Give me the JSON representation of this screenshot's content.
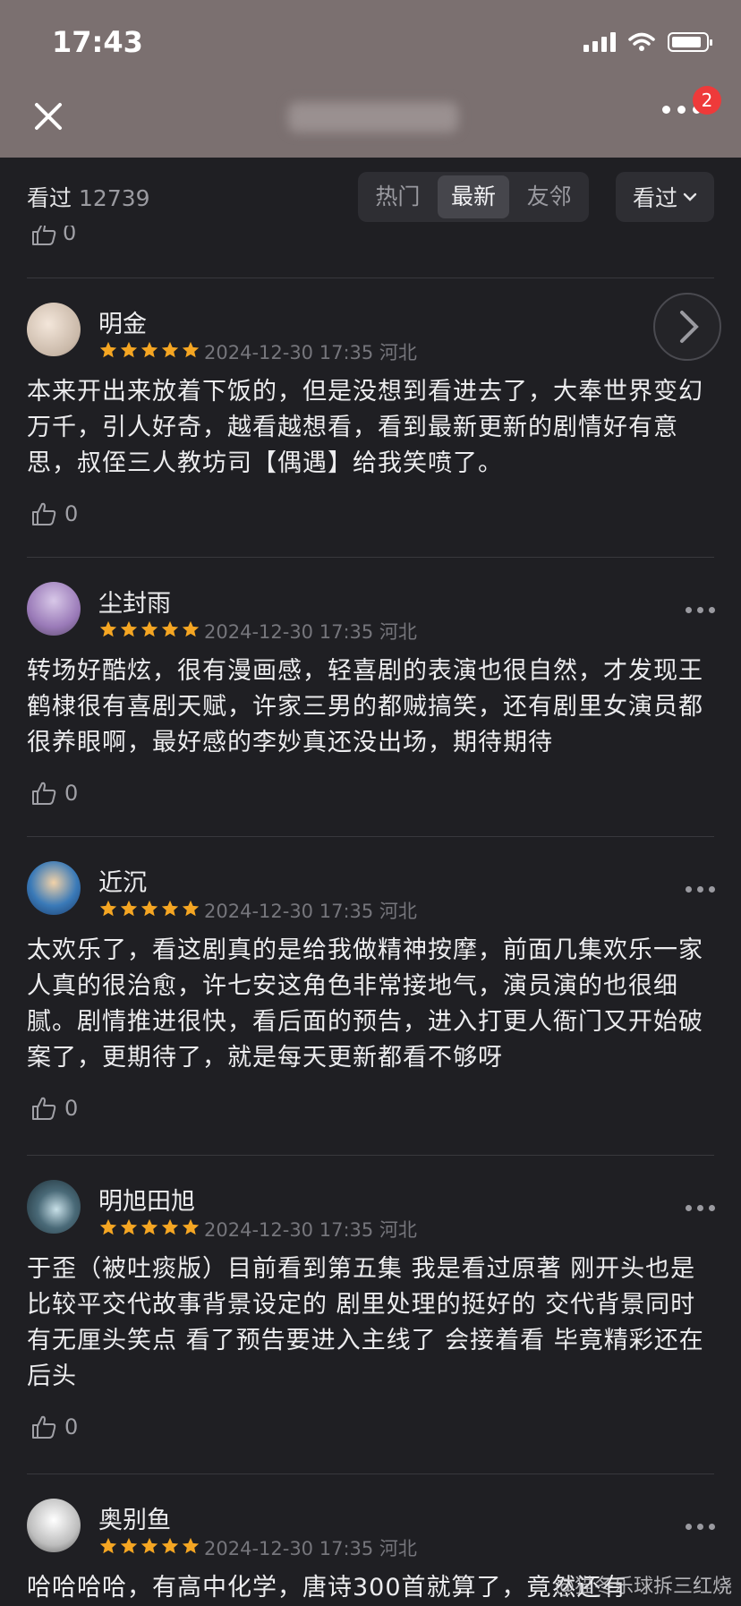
{
  "status_bar": {
    "time": "17:43"
  },
  "header": {
    "badge_count": "2"
  },
  "filter_bar": {
    "viewed_label": "看过",
    "viewed_count": "12739",
    "tabs": [
      {
        "label": "热门",
        "active": false
      },
      {
        "label": "最新",
        "active": true
      },
      {
        "label": "友邻",
        "active": false
      }
    ],
    "sort_label": "看过"
  },
  "previous_comment": {
    "likes": "0"
  },
  "comments": [
    {
      "username": "明金",
      "rating": 5,
      "meta": "2024-12-30 17:35 河北",
      "text": "本来开出来放着下饭的，但是没想到看进去了，大奉世界变幻万千，引人好奇，越看越想看，看到最新更新的剧情好有意思，叔侄三人教坊司【偶遇】给我笑喷了。",
      "likes": "0"
    },
    {
      "username": "尘封雨",
      "rating": 5,
      "meta": "2024-12-30 17:35 河北",
      "text": "转场好酷炫，很有漫画感，轻喜剧的表演也很自然，才发现王鹤棣很有喜剧天赋，许家三男的都贼搞笑，还有剧里女演员都很养眼啊，最好感的李妙真还没出场，期待期待",
      "likes": "0"
    },
    {
      "username": "近沉",
      "rating": 5,
      "meta": "2024-12-30 17:35 河北",
      "text": "太欢乐了，看这剧真的是给我做精神按摩，前面几集欢乐一家人真的很治愈，许七安这角色非常接地气，演员演的也很细腻。剧情推进很快，看后面的预告，进入打更人衙门又开始破案了，更期待了，就是每天更新都看不够呀",
      "likes": "0"
    },
    {
      "username": "明旭田旭",
      "rating": 5,
      "meta": "2024-12-30 17:35 河北",
      "text": "于歪（被吐痰版）目前看到第五集 我是看过原著 刚开头也是比较平交代故事背景设定的 剧里处理的挺好的 交代背景同时有无厘头笑点 看了预告要进入主线了 会接着看 毕竟精彩还在后头",
      "likes": "0"
    },
    {
      "username": "奥别鱼",
      "rating": 5,
      "meta": "2024-12-30 17:35 河北",
      "text": "哈哈哈哈，有高中化学，唐诗300首就算了，竟然还有",
      "likes": ""
    }
  ],
  "watermark": "@猫冬乐球拆三红烧",
  "colors": {
    "star": "#f5a623",
    "badge": "#ee3a3a",
    "header_bg": "#7b7070",
    "page_bg": "#1f1f23"
  }
}
